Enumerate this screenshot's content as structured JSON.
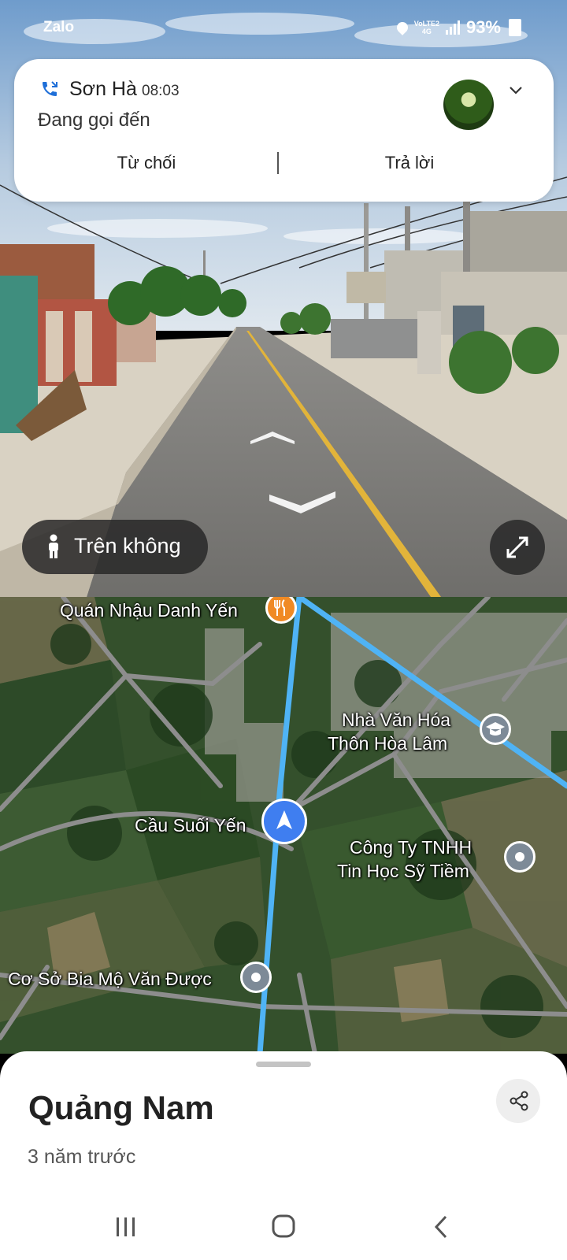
{
  "status_bar": {
    "app": "Zalo",
    "network": "VoLTE2",
    "network_type": "4G",
    "battery": "93%",
    "icons": [
      "location-icon",
      "signal-icon",
      "battery-icon"
    ]
  },
  "call_notification": {
    "caller": "Sơn Hà",
    "time": "08:03",
    "status": "Đang gọi đến",
    "decline_label": "Từ chối",
    "answer_label": "Trả lời",
    "icons": [
      "incoming-call-icon",
      "chevron-down-icon"
    ]
  },
  "street_view": {
    "mode_label": "Trên không",
    "icons": [
      "person-icon",
      "expand-icon",
      "forward-arrow-icon",
      "backward-arrow-icon"
    ]
  },
  "map": {
    "pois": [
      {
        "name": "Quán Nhậu Danh Yến",
        "icon": "restaurant-icon"
      },
      {
        "name": "Nhà Văn Hóa Thôn Hòa Lâm",
        "line1": "Nhà Văn Hóa",
        "line2": "Thôn Hòa Lâm",
        "icon": "school-icon"
      },
      {
        "name": "Cầu Suối Yến",
        "icon": "location-arrow-icon"
      },
      {
        "name": "Công Ty TNHH Tin Học Sỹ Tiềm",
        "line1": "Công Ty TNHH",
        "line2": "Tin Học Sỹ Tiềm",
        "icon": "place-pin-icon"
      },
      {
        "name": "Cơ Sở Bia Mộ Văn Được",
        "icon": "place-pin-icon"
      }
    ],
    "colors": {
      "route": "#4fb3f5",
      "road": "#8b8b8b",
      "you_marker": "#3f7ef0"
    }
  },
  "place_sheet": {
    "title": "Quảng Nam",
    "date": "3 năm trước",
    "icons": [
      "share-icon"
    ]
  },
  "nav_bar": {
    "icons": [
      "recent-apps-icon",
      "home-icon",
      "back-icon"
    ]
  }
}
